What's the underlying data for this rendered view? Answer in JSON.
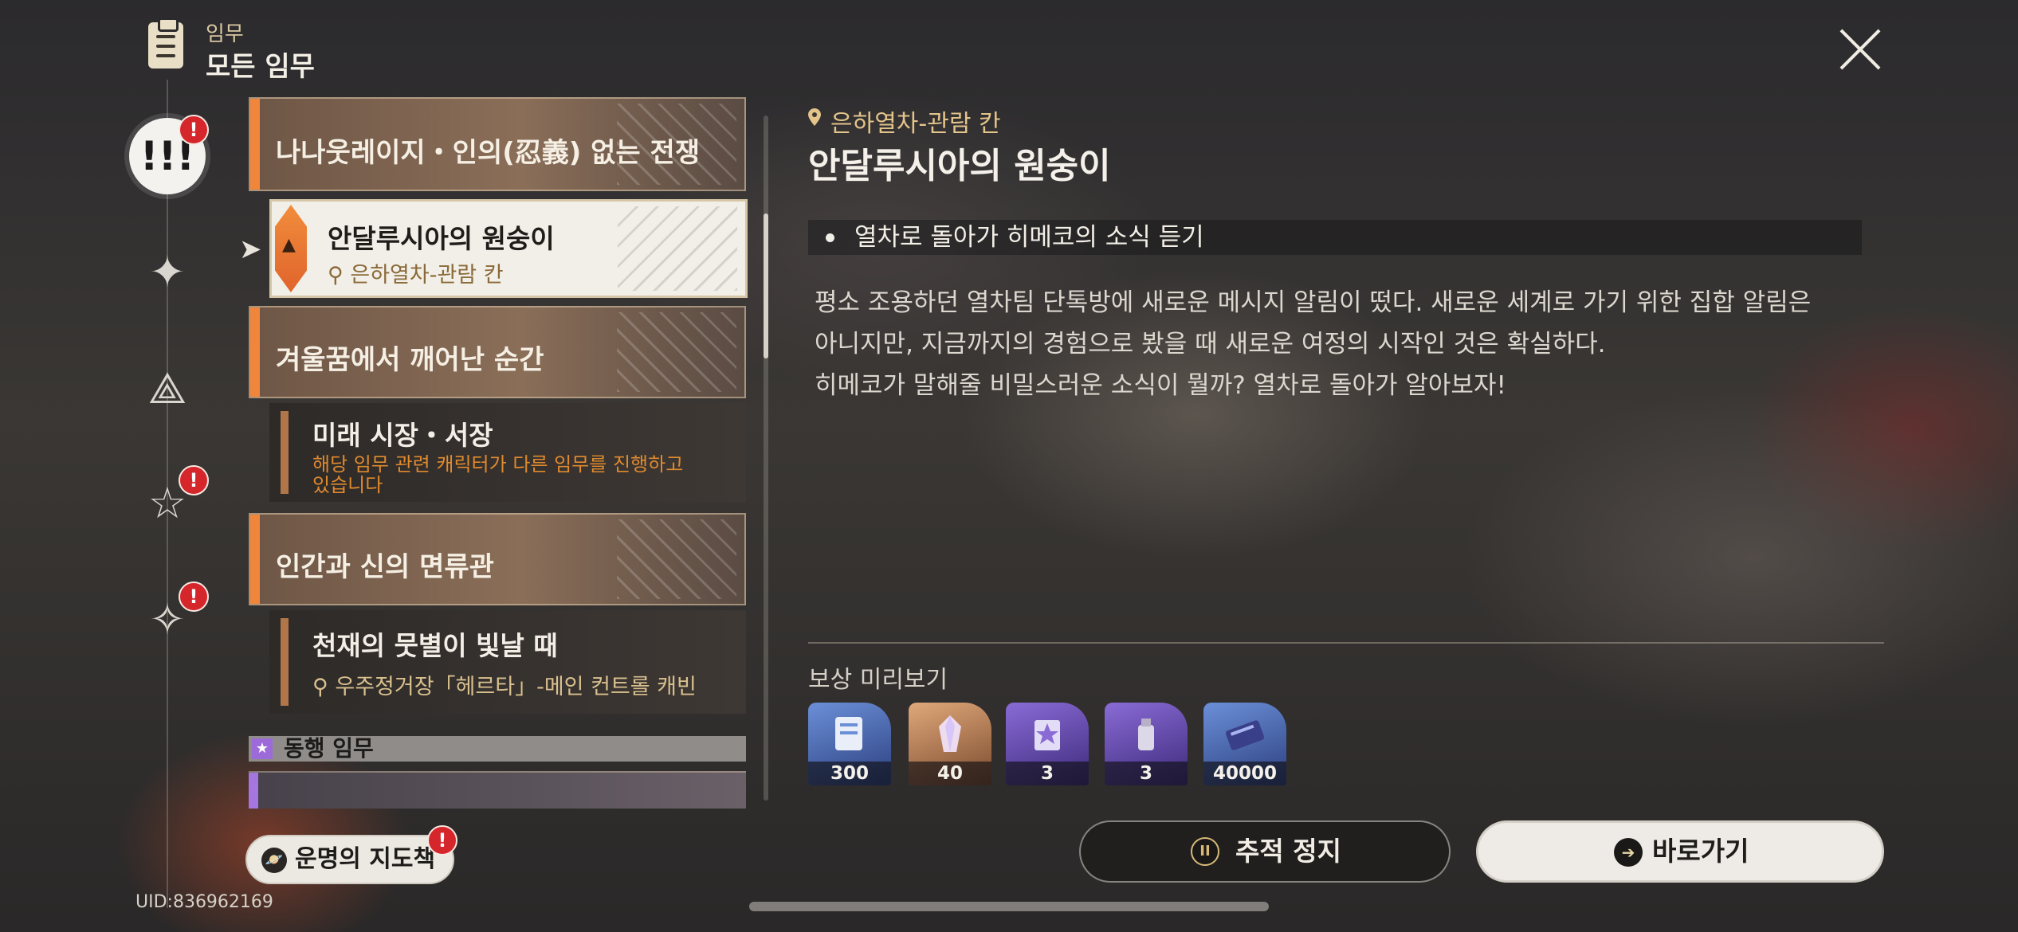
{
  "header": {
    "subtitle": "임무",
    "title": "모든 임무"
  },
  "rail": {
    "items": [
      {
        "name": "all-missions",
        "glyph": "!!!",
        "badge": "!"
      },
      {
        "name": "diamond-star",
        "glyph": "✦",
        "badge": ""
      },
      {
        "name": "triangle",
        "glyph": "⟁",
        "badge": ""
      },
      {
        "name": "star",
        "glyph": "☆",
        "badge": "!"
      },
      {
        "name": "four-point-star",
        "glyph": "✧",
        "badge": "!"
      }
    ]
  },
  "missions": {
    "group1": "나나웃레이지・인의(忍義) 없는 전쟁",
    "selected": {
      "title": "안달루시아의 원숭이",
      "location": "은하열차-관람 칸"
    },
    "group2": "겨울꿈에서 깨어난 순간",
    "sub2": {
      "title": "미래 시장・서장",
      "note": "해당 임무 관련 캐릭터가 다른 임무를 진행하고 있습니다"
    },
    "group3": "인간과 신의 면류관",
    "sub3": {
      "title": "천재의 뭇별이 빛날 때",
      "location": "우주정거장「헤르타」-메인 컨트롤 캐빈"
    },
    "category": "동행 임무"
  },
  "detail": {
    "location": "은하열차-관람 칸",
    "title": "안달루시아의 원숭이",
    "objective": "열차로 돌아가 히메코의 소식 듣기",
    "desc1": "평소 조용하던 열차팀 단톡방에 새로운 메시지 알림이 떴다. 새로운 세계로 가기 위한 집합 알림은",
    "desc2": "아니지만, 지금까지의 경험으로 봤을 때 새로운 여정의 시작인 것은 확실하다.",
    "desc3": "히메코가 말해줄 비밀스러운 소식이 뭘까? 열차로 돌아가 알아보자!",
    "reward_title": "보상 미리보기",
    "rewards": [
      {
        "amount": "300",
        "color": "#3e5fa8"
      },
      {
        "amount": "40",
        "color": "#b07a4a"
      },
      {
        "amount": "3",
        "color": "#5a3f9a"
      },
      {
        "amount": "3",
        "color": "#5a3f9a"
      },
      {
        "amount": "40000",
        "color": "#3e5fa8"
      }
    ]
  },
  "buttons": {
    "track": "추적 정지",
    "go": "바로가기",
    "guide": "운명의 지도책",
    "guide_badge": "!"
  },
  "uid": "UID:836962169",
  "colors": {
    "accent_orange": "#f0853c",
    "badge_red": "#d5262b",
    "gold": "#e3c48a"
  }
}
